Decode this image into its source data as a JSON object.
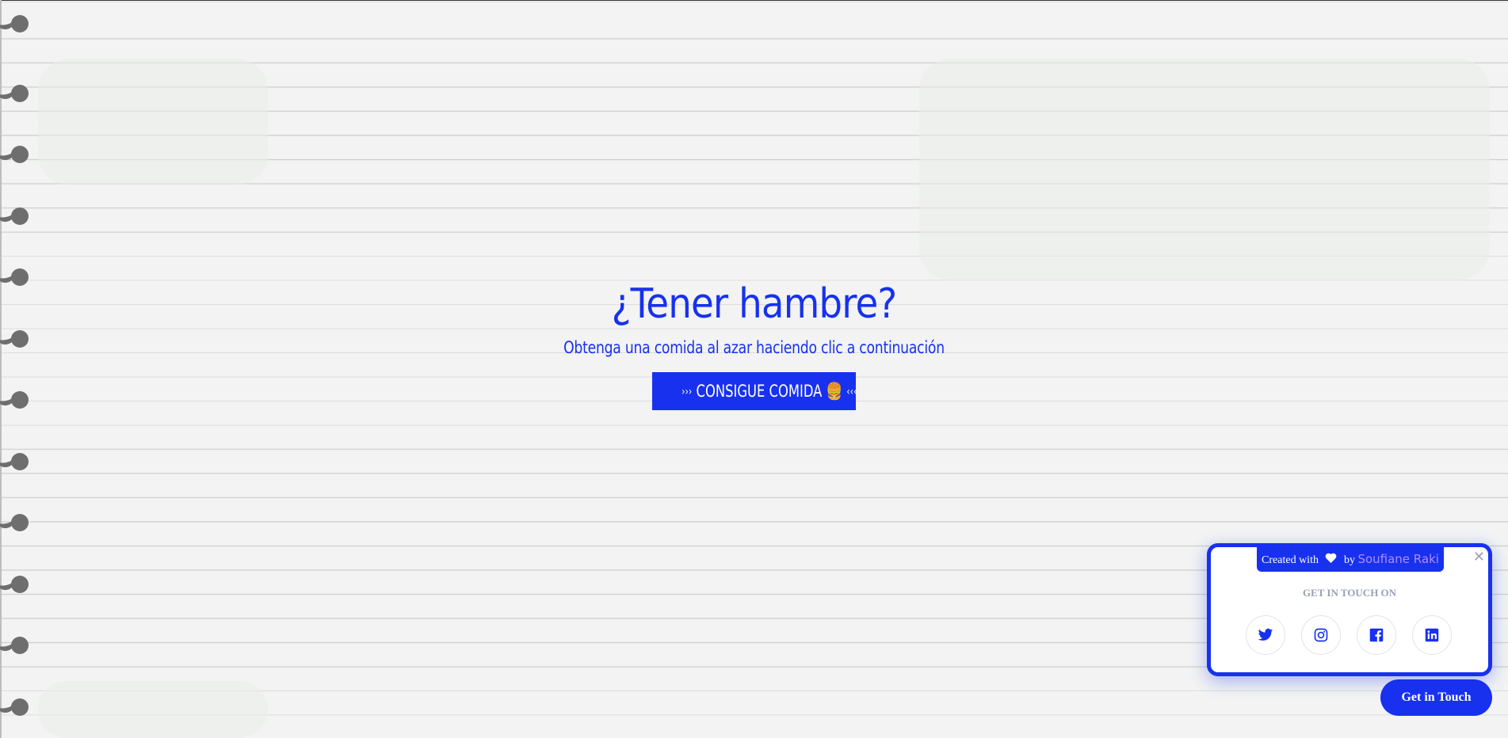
{
  "hero": {
    "title": "¿Tener hambre?",
    "subtitle": "Obtenga una comida al azar haciendo clic a continuación",
    "button": {
      "prefix": "›››",
      "label": "CONSIGUE COMIDA",
      "emoji": "🍔",
      "suffix": "‹‹‹"
    }
  },
  "widget": {
    "created_with": "Created with",
    "by": "by",
    "author": "Soufiane Raki",
    "close_symbol": "✕",
    "label": "GET IN TOUCH ON",
    "socials": [
      {
        "name": "twitter",
        "icon": "twitter-icon"
      },
      {
        "name": "instagram",
        "icon": "instagram-icon"
      },
      {
        "name": "facebook",
        "icon": "facebook-icon"
      },
      {
        "name": "linkedin",
        "icon": "linkedin-icon"
      }
    ]
  },
  "get_in_touch_label": "Get in Touch",
  "colors": {
    "accent": "#1731ef",
    "background": "#f2f3f2",
    "line": "#cfd1cf",
    "ring": "#6e6e6e",
    "author": "#b18cff",
    "muted": "#9aa0b8"
  }
}
